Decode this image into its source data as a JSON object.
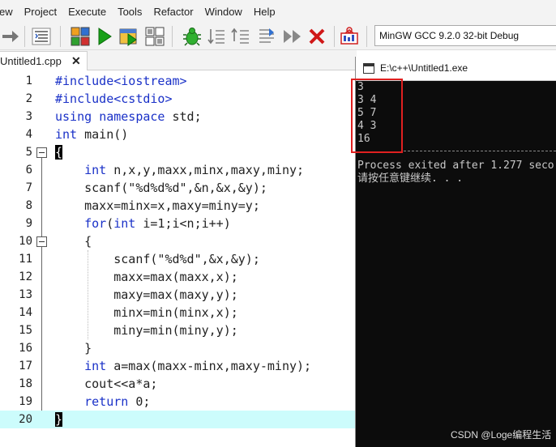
{
  "menu": [
    "ew",
    "Project",
    "Execute",
    "Tools",
    "Refactor",
    "Window",
    "Help"
  ],
  "toolbar": {
    "icons": [
      "arrow-right-icon",
      "indent-format-icon",
      "compile-icon",
      "run-icon",
      "compile-run-icon",
      "rebuild-icon",
      "debug-icon",
      "step-icon",
      "toggle-breakpoint-icon",
      "continue-icon",
      "stop-debug-icon",
      "profile-icon"
    ],
    "compiler": "MinGW GCC 9.2.0 32-bit Debug"
  },
  "tab": {
    "title": "Untitled1.cpp",
    "close": "✕"
  },
  "editor": {
    "lines": [
      {
        "n": "1",
        "code": "#include<iostream>"
      },
      {
        "n": "2",
        "code": "#include<cstdio>"
      },
      {
        "n": "3",
        "code": "using namespace std;"
      },
      {
        "n": "4",
        "code": "int main()"
      },
      {
        "n": "5",
        "code": "{"
      },
      {
        "n": "6",
        "code": "    int n,x,y,maxx,minx,maxy,miny;"
      },
      {
        "n": "7",
        "code": "    scanf(\"%d%d%d\",&n,&x,&y);"
      },
      {
        "n": "8",
        "code": "    maxx=minx=x,maxy=miny=y;"
      },
      {
        "n": "9",
        "code": "    for(int i=1;i<n;i++)"
      },
      {
        "n": "10",
        "code": "    {"
      },
      {
        "n": "11",
        "code": "        scanf(\"%d%d\",&x,&y);"
      },
      {
        "n": "12",
        "code": "        maxx=max(maxx,x);"
      },
      {
        "n": "13",
        "code": "        maxy=max(maxy,y);"
      },
      {
        "n": "14",
        "code": "        minx=min(minx,x);"
      },
      {
        "n": "15",
        "code": "        miny=min(miny,y);"
      },
      {
        "n": "16",
        "code": "    }"
      },
      {
        "n": "17",
        "code": "    int a=max(maxx-minx,maxy-miny);"
      },
      {
        "n": "18",
        "code": "    cout<<a*a;"
      },
      {
        "n": "19",
        "code": "    return 0;"
      },
      {
        "n": "20",
        "code": "}"
      }
    ],
    "highlighted_line": "20",
    "keyword_color": "#1a31c8",
    "highlight_color": "#ccfcfc"
  },
  "console": {
    "title": "E:\\c++\\Untitled1.exe",
    "input_lines": [
      "3",
      "3 4",
      "5 7",
      "4 3",
      "16"
    ],
    "exit_line": "Process exited after 1.277 seco",
    "continue_line": "请按任意键继续. . .",
    "box_color": "#e02020"
  },
  "watermark": "CSDN @Loge编程生活"
}
